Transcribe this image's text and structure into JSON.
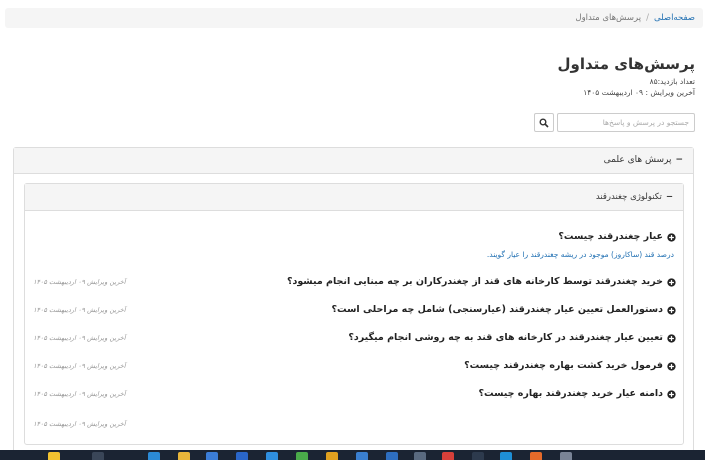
{
  "breadcrumb": {
    "home": "صفحه‌اصلی",
    "separator": "/",
    "current": "پرسش‌های متداول"
  },
  "page": {
    "title": "پرسش‌های متداول",
    "visit_count": "تعداد بازدید:۸۵",
    "last_edited": "آخرین ویرایش : ۰۹ اردیبهشت ۱۴۰۵"
  },
  "search": {
    "placeholder": "جستجو در پرسش و پاسخ‌ها",
    "button_icon": "search-icon"
  },
  "category": {
    "label": "پرسش های علمی",
    "toggle": "−"
  },
  "subcategory": {
    "label": "تکنولوژی چغندرقند",
    "toggle": "−"
  },
  "questions": [
    {
      "title": "عیار چغندرقند چیست؟",
      "answer": "درصد قند (ساکاروز) موجود در ریشه چغندرقند را عیار گویند."
    },
    {
      "title": "خرید چغندرقند توسط کارخانه های قند از چغندرکاران بر چه مبنایی انجام میشود؟",
      "date": "آخرین ویرایش ۰۹ اردیبهشت ۱۴۰۵"
    },
    {
      "title": "دستورالعمل تعیین عیار چغندرقند (عیارسنجی) شامل چه مراحلی است؟",
      "date": "آخرین ویرایش ۰۹ اردیبهشت ۱۴۰۵"
    },
    {
      "title": "تعیین عیار چغندرقند در کارخانه های قند به چه روشی انجام میگیرد؟",
      "date": "آخرین ویرایش ۰۹ اردیبهشت ۱۴۰۵"
    },
    {
      "title": "فرمول خرید کشت بهاره چغندرقند چیست؟",
      "date": "آخرین ویرایش ۰۹ اردیبهشت ۱۴۰۵"
    },
    {
      "title": "دامنه عیار خرید چغندرقند بهاره چیست؟",
      "date": "آخرین ویرایش ۰۹ اردیبهشت ۱۴۰۵"
    }
  ],
  "trailing_date": "آخرین ویرایش ۰۹ اردیبهشت ۱۴۰۵",
  "colors": {
    "link": "#1f6fb2",
    "panel_heading_bg": "#f5f5f5",
    "border": "#dddddd",
    "taskbar": "#1b2433"
  }
}
